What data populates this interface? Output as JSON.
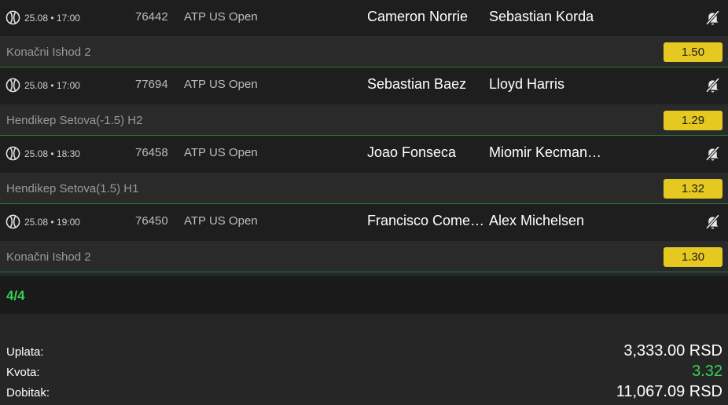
{
  "matches": [
    {
      "date": "25.08 • 17:00",
      "code": "76442",
      "league": "ATP US Open",
      "home": "Cameron Norrie",
      "away": "Sebastian Korda",
      "pick": "Konačni Ishod 2",
      "odd": "1.50"
    },
    {
      "date": "25.08 • 17:00",
      "code": "77694",
      "league": "ATP US Open",
      "home": "Sebastian Baez",
      "away": "Lloyd Harris",
      "pick": "Hendikep Setova(-1.5) H2",
      "odd": "1.29"
    },
    {
      "date": "25.08 • 18:30",
      "code": "76458",
      "league": "ATP US Open",
      "home": "Joao Fonseca",
      "away": "Miomir Kecmanović",
      "pick": "Hendikep Setova(1.5) H1",
      "odd": "1.32"
    },
    {
      "date": "25.08 • 19:00",
      "code": "76450",
      "league": "ATP US Open",
      "home": "Francisco Comesaña",
      "away": "Alex Michelsen",
      "pick": "Konačni Ishod 2",
      "odd": "1.30"
    }
  ],
  "icons": {
    "sport": "tennis-ball-icon",
    "bell": "bell-off-icon"
  },
  "counter": "4/4",
  "summary": {
    "stake_label": "Uplata:",
    "stake_value": "3,333.00 RSD",
    "odds_label": "Kvota:",
    "odds_value": "3.32",
    "win_label": "Dobitak:",
    "win_value": "11,067.09 RSD"
  },
  "colors": {
    "accent_green": "#36d14f",
    "odd_yellow": "#e5c920",
    "divider_green": "#1e7a33"
  }
}
